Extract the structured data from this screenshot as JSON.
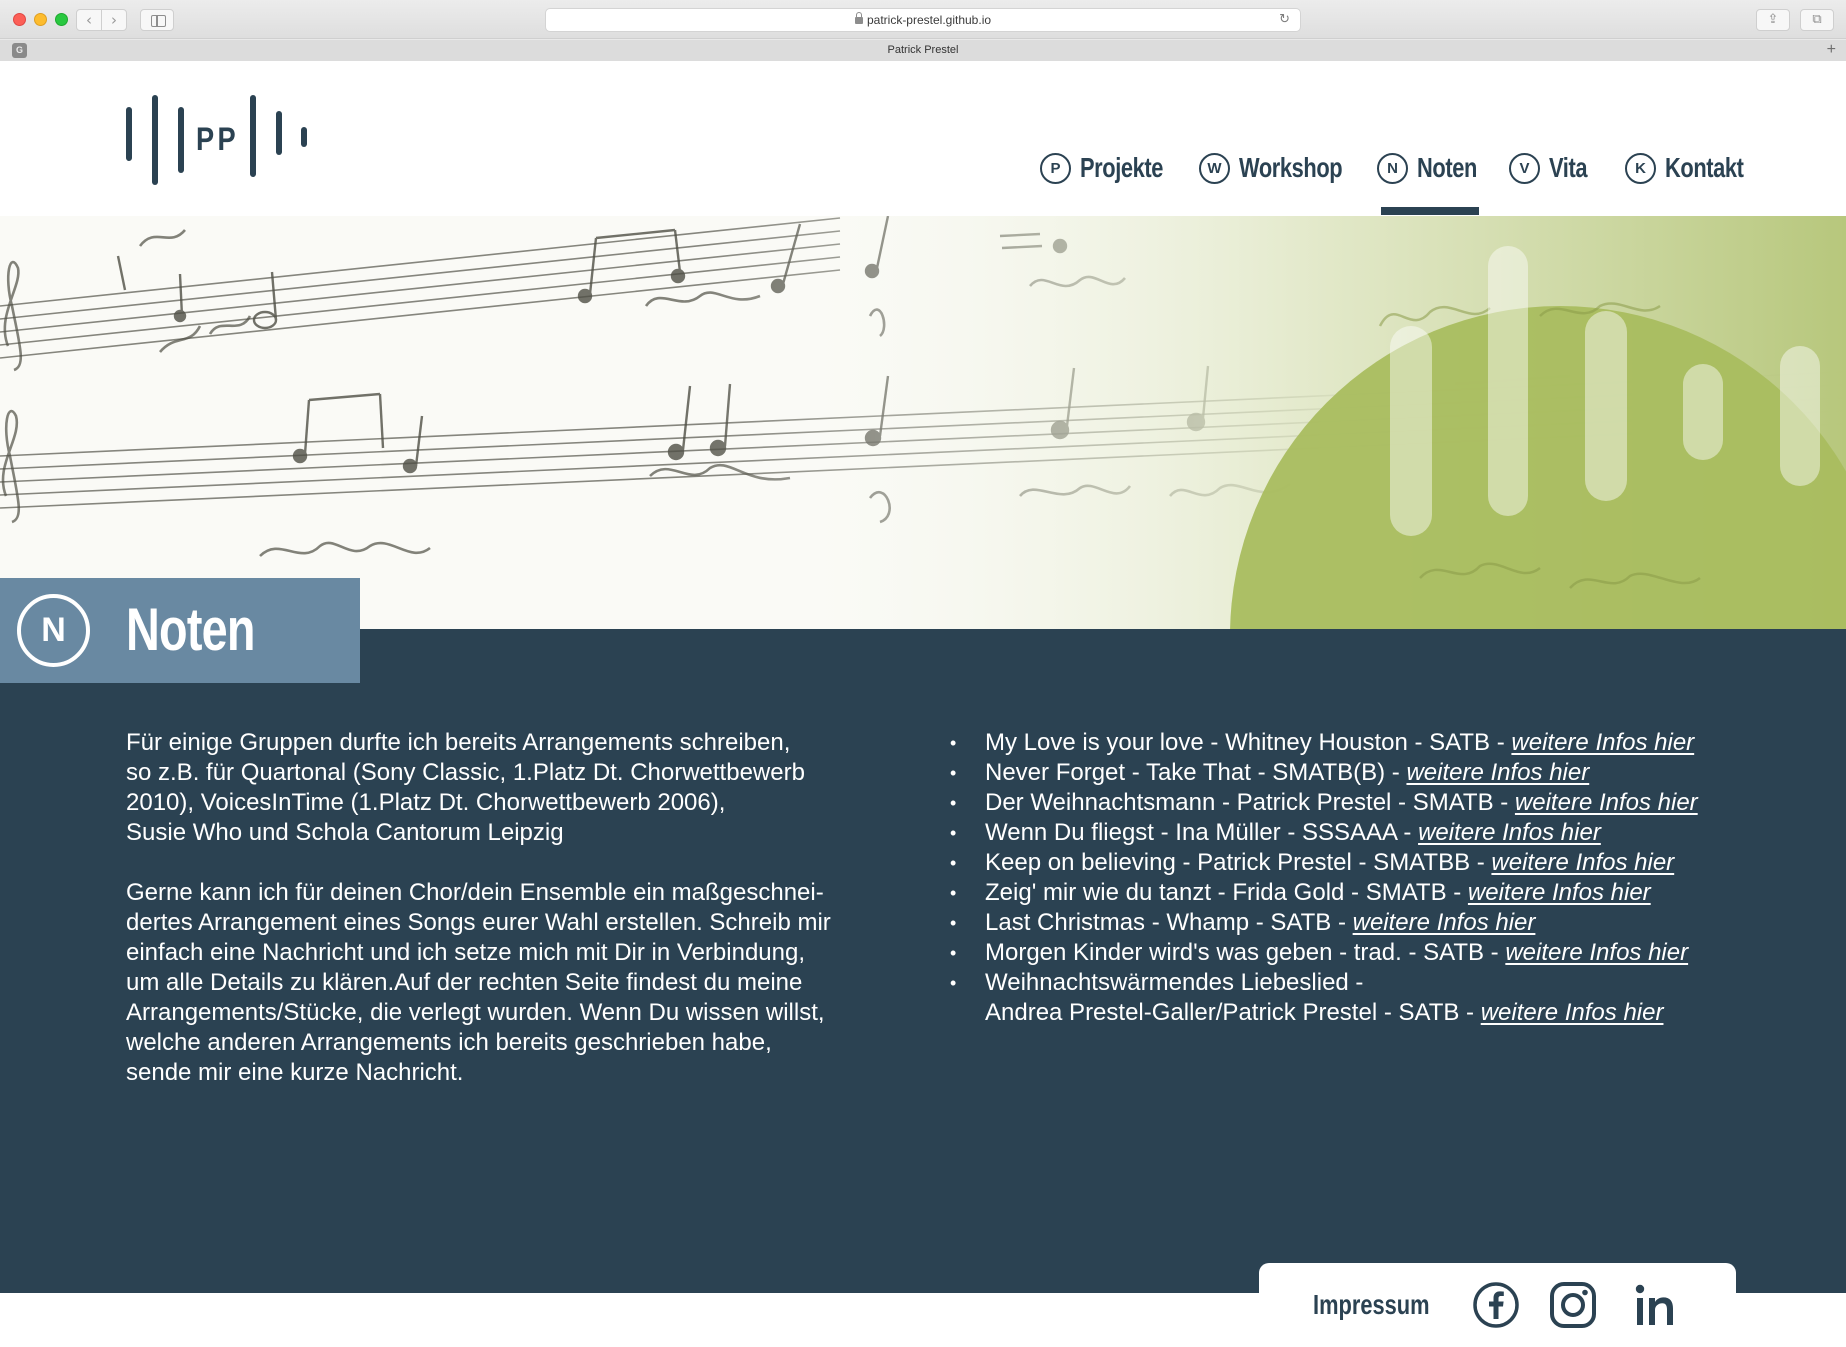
{
  "browser": {
    "url": "patrick-prestel.github.io",
    "tab_title": "Patrick Prestel",
    "favicon_letter": "G",
    "back_symbol": "‹",
    "forward_symbol": "›",
    "reload_symbol": "↻",
    "share_symbol": "⇪",
    "tabs_symbol": "⧉",
    "new_tab_symbol": "+"
  },
  "logo": {
    "text": "PP",
    "icon": "pp-logo-bars"
  },
  "nav": {
    "items": [
      {
        "badge": "P",
        "label": "Projekte",
        "active": false
      },
      {
        "badge": "W",
        "label": "Workshop",
        "active": false
      },
      {
        "badge": "N",
        "label": "Noten",
        "active": true
      },
      {
        "badge": "V",
        "label": "Vita",
        "active": false
      },
      {
        "badge": "K",
        "label": "Kontakt",
        "active": false
      }
    ]
  },
  "page": {
    "badge": "N",
    "title": "Noten"
  },
  "intro": {
    "p1": [
      "Für einige Gruppen durfte ich bereits Arrangements schreiben,",
      "so z.B. für Quartonal (Sony Classic, 1.Platz Dt. Chorwettbewerb",
      "2010), VoicesInTime (1.Platz Dt. Chorwettbewerb 2006),",
      "Susie Who und Schola Cantorum Leipzig"
    ],
    "p2": [
      "Gerne kann ich für deinen Chor/dein Ensemble ein maßgeschnei-",
      "dertes Arrangement eines Songs eurer Wahl erstellen. Schreib mir",
      "einfach eine Nachricht und ich setze mich mit Dir in Verbindung,",
      "um alle Details zu klären.Auf der rechten Seite findest du meine",
      "Arrangements/Stücke, die verlegt wurden. Wenn Du wissen willst,",
      "welche anderen Arrangements ich bereits geschrieben habe,",
      "sende mir eine kurze Nachricht."
    ]
  },
  "arrangements": {
    "link_label": "weitere Infos hier",
    "items": [
      {
        "text": "My Love is your love - Whitney Houston - SATB - "
      },
      {
        "text": "Never Forget - Take That - SMATB(B) - "
      },
      {
        "text": "Der Weihnachtsmann - Patrick Prestel - SMATB - "
      },
      {
        "text": "Wenn Du fliegst - Ina Müller - SSSAAA - "
      },
      {
        "text": "Keep on believing - Patrick Prestel - SMATBB - "
      },
      {
        "text": "Zeig' mir wie du tanzt - Frida Gold - SMATB - "
      },
      {
        "text": "Last Christmas - Whamp - SATB - "
      },
      {
        "text": "Morgen Kinder wird's was geben - trad. - SATB - "
      }
    ],
    "last_item": {
      "line1": "Weihnachtswärmendes Liebeslied -",
      "line2": "Andrea Prestel-Galler/Patrick Prestel - SATB - "
    }
  },
  "footer": {
    "impressum": "Impressum",
    "social": [
      "facebook-icon",
      "instagram-icon",
      "linkedin-icon"
    ]
  },
  "colors": {
    "navy": "#2b4252",
    "title_box": "#6989a2",
    "hero_green": "#a7bb5d",
    "white": "#ffffff"
  }
}
